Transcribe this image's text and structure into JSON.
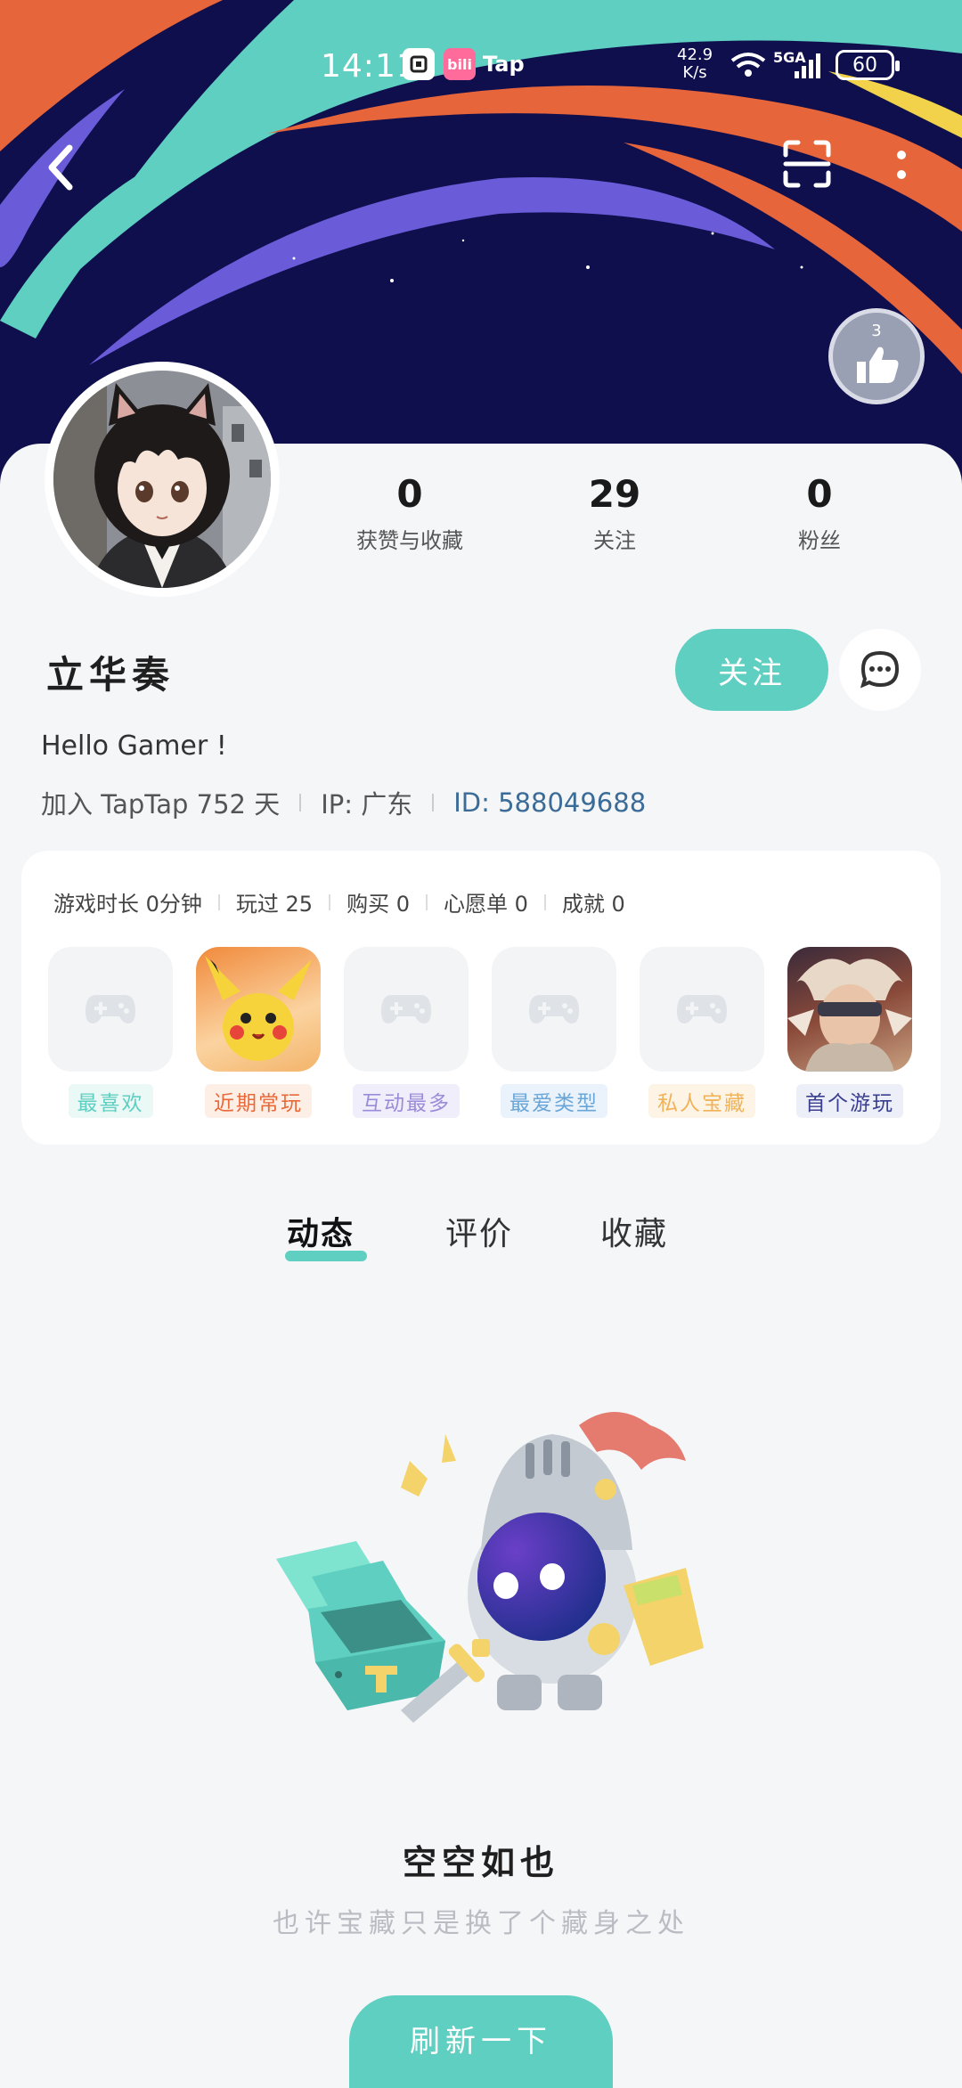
{
  "status_bar": {
    "time": "14:11",
    "app_icon_2": "bili",
    "app_icon_3": "Tap",
    "net_speed": "42.9",
    "net_unit": "K/s",
    "network": "5GA",
    "battery": "60"
  },
  "header": {
    "like_badge_count": "3"
  },
  "profile": {
    "username": "立华奏",
    "bio": "Hello Gamer !",
    "joined": "加入 TapTap 752 天",
    "ip": "IP: 广东",
    "id": "ID: 588049688",
    "follow_label": "关注"
  },
  "stats": [
    {
      "value": "0",
      "label": "获赞与收藏"
    },
    {
      "value": "29",
      "label": "关注"
    },
    {
      "value": "0",
      "label": "粉丝"
    }
  ],
  "games": {
    "stats": [
      "游戏时长 0分钟",
      "玩过 25",
      "购买 0",
      "心愿单 0",
      "成就 0"
    ],
    "tiles": [
      {
        "label": "最喜欢",
        "color": "#5ecfc0"
      },
      {
        "label": "近期常玩",
        "color": "#e86a3a"
      },
      {
        "label": "互动最多",
        "color": "#9b8cd9"
      },
      {
        "label": "最爱类型",
        "color": "#6aa6d8"
      },
      {
        "label": "私人宝藏",
        "color": "#f0b35a"
      },
      {
        "label": "首个游玩",
        "color": "#3a3f8f"
      }
    ]
  },
  "tabs": [
    "动态",
    "评价",
    "收藏"
  ],
  "empty_state": {
    "title": "空空如也",
    "subtitle": "也许宝藏只是换了个藏身之处",
    "refresh_label": "刷新一下"
  },
  "colors": {
    "accent": "#5ecfc0",
    "banner_bg": "#0f0f4d",
    "id_text": "#3b6b97"
  }
}
